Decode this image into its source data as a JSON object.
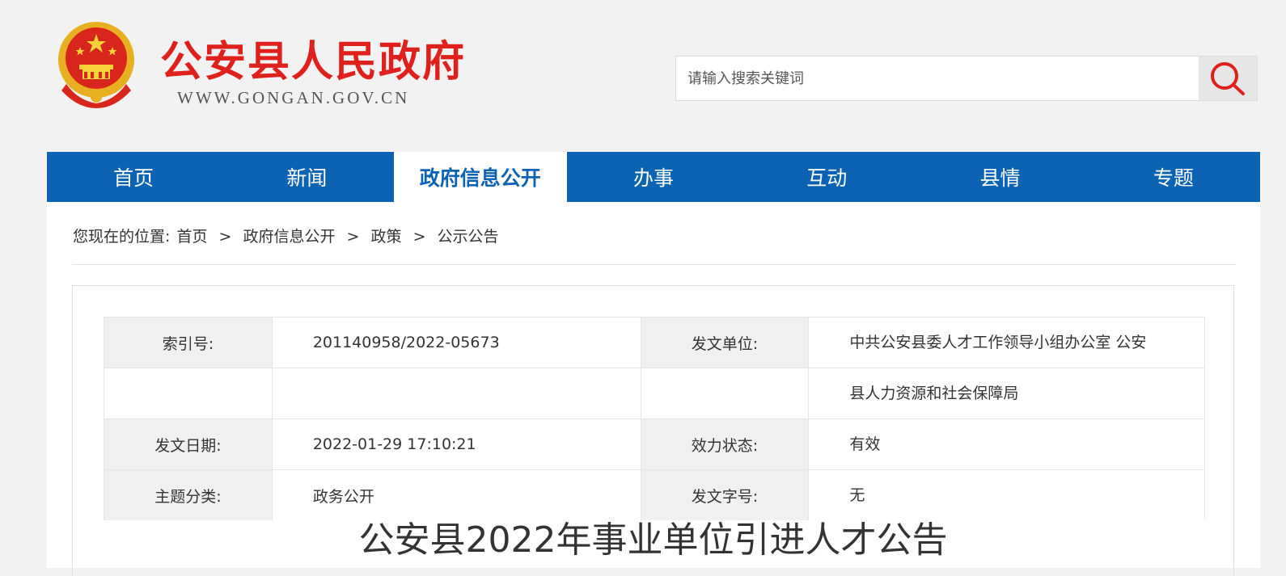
{
  "header": {
    "site_title": "公安县人民政府",
    "site_url": "WWW.GONGAN.GOV.CN",
    "emblem_icon": "national-emblem-icon"
  },
  "search": {
    "placeholder": "请输入搜索关键词",
    "value": "",
    "button_icon": "search-icon"
  },
  "nav": {
    "items": [
      {
        "label": "首页"
      },
      {
        "label": "新闻"
      },
      {
        "label": "政府信息公开",
        "active": true
      },
      {
        "label": "办事"
      },
      {
        "label": "互动"
      },
      {
        "label": "县情"
      },
      {
        "label": "专题"
      }
    ]
  },
  "breadcrumb": {
    "prefix": "您现在的位置:",
    "items": [
      "首页",
      "政府信息公开",
      "政策",
      "公示公告"
    ],
    "separator": ">"
  },
  "document": {
    "meta": {
      "index_label": "索引号:",
      "index_value": "201140958/2022-05673",
      "issuer_label": "发文单位:",
      "issuer_value_line1": "中共公安县委人才工作领导小组办公室 公安",
      "issuer_value_line2": "县人力资源和社会保障局",
      "date_label": "发文日期:",
      "date_value": "2022-01-29 17:10:21",
      "status_label": "效力状态:",
      "status_value": "有效",
      "category_label": "主题分类:",
      "category_value": "政务公开",
      "docnum_label": "发文字号:",
      "docnum_value": "无"
    },
    "title": "公安县2022年事业单位引进人才公告"
  },
  "colors": {
    "brand_red": "#e0211b",
    "nav_blue": "#0d63b3",
    "page_bg": "#f2f2f2"
  }
}
